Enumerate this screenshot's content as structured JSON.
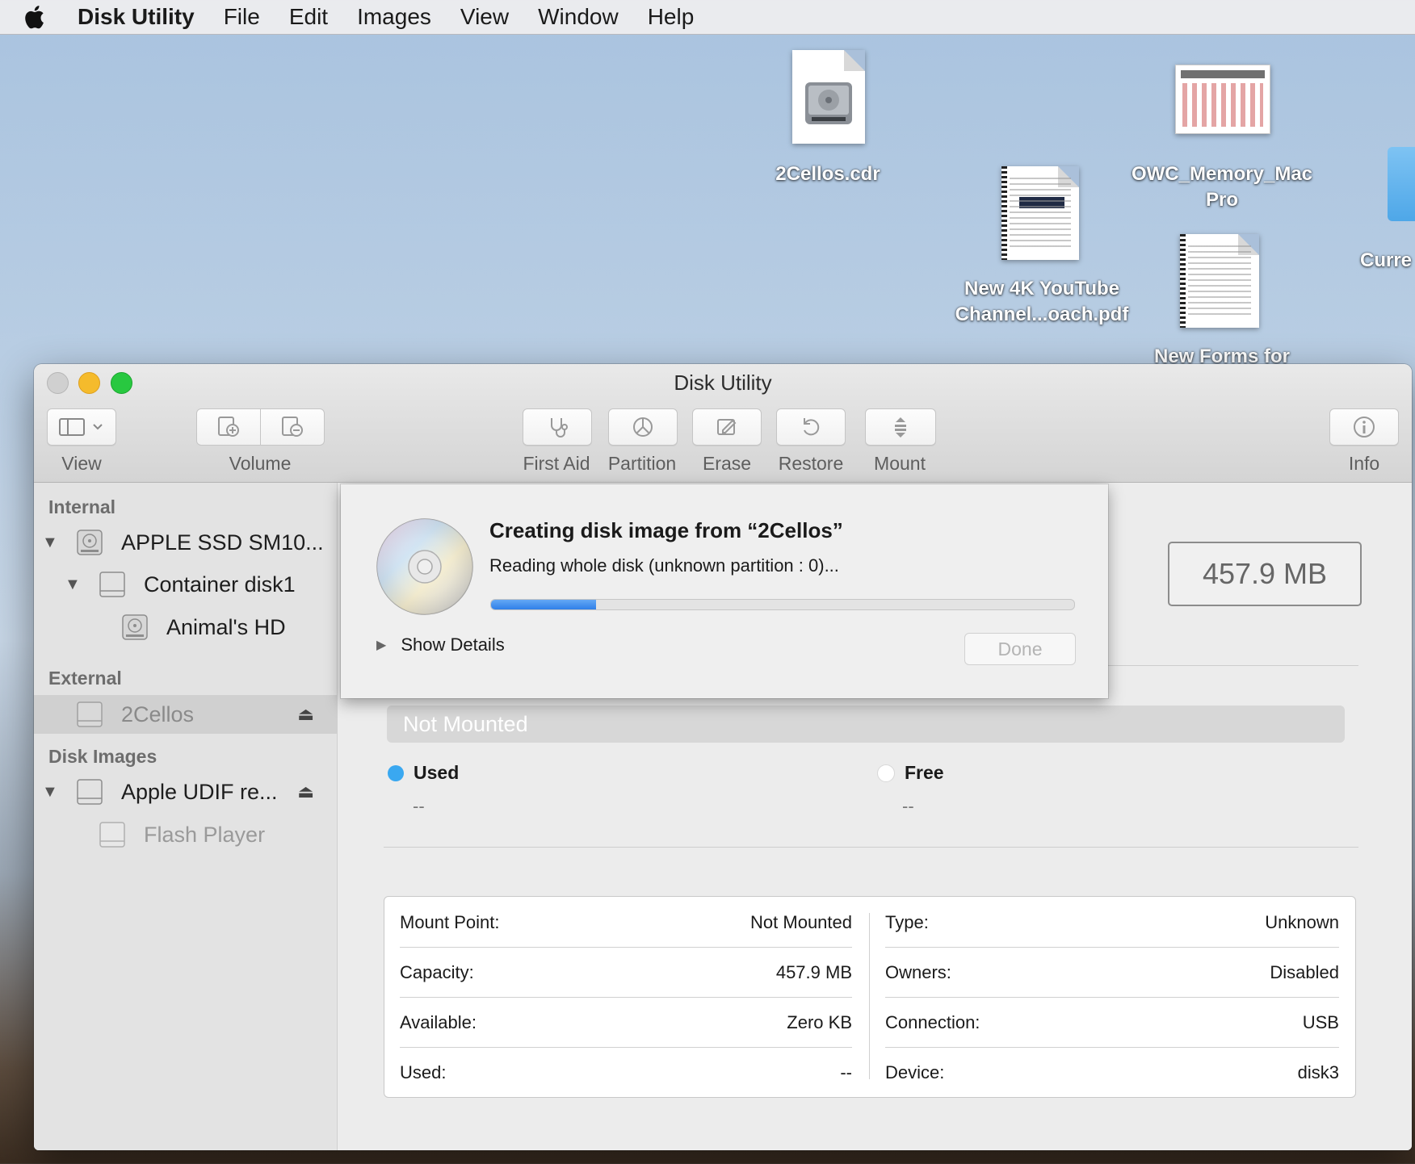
{
  "menubar": {
    "app_name": "Disk Utility",
    "items": [
      "File",
      "Edit",
      "Images",
      "View",
      "Window",
      "Help"
    ]
  },
  "desktop": {
    "icons": [
      {
        "label": "2Cellos.cdr"
      },
      {
        "label": "OWC_Memory_Mac Pro"
      },
      {
        "label": "New 4K YouTube Channel...oach.pdf"
      },
      {
        "label": "New Forms for"
      },
      {
        "label": "Curre O"
      }
    ]
  },
  "window": {
    "title": "Disk Utility",
    "toolbar": {
      "view_label": "View",
      "volume_label": "Volume",
      "first_aid_label": "First Aid",
      "partition_label": "Partition",
      "erase_label": "Erase",
      "restore_label": "Restore",
      "mount_label": "Mount",
      "info_label": "Info"
    }
  },
  "sidebar": {
    "sections": [
      {
        "header": "Internal"
      },
      {
        "header": "External"
      },
      {
        "header": "Disk Images"
      }
    ],
    "items": [
      {
        "label": "APPLE SSD SM10..."
      },
      {
        "label": "Container disk1"
      },
      {
        "label": "Animal's HD"
      },
      {
        "label": "2Cellos"
      },
      {
        "label": "Apple UDIF re..."
      },
      {
        "label": "Flash Player"
      }
    ]
  },
  "main": {
    "size": "457.9 MB",
    "usage_bar_label": "Not Mounted",
    "legend": {
      "used_label": "Used",
      "used_value": "--",
      "used_color": "#3aa8f0",
      "free_label": "Free",
      "free_value": "--",
      "free_color": "#ffffff"
    },
    "info_left": [
      {
        "key": "Mount Point:",
        "value": "Not Mounted"
      },
      {
        "key": "Capacity:",
        "value": "457.9 MB"
      },
      {
        "key": "Available:",
        "value": "Zero KB"
      },
      {
        "key": "Used:",
        "value": "--"
      }
    ],
    "info_right": [
      {
        "key": "Type:",
        "value": "Unknown"
      },
      {
        "key": "Owners:",
        "value": "Disabled"
      },
      {
        "key": "Connection:",
        "value": "USB"
      },
      {
        "key": "Device:",
        "value": "disk3"
      }
    ]
  },
  "sheet": {
    "title": "Creating disk image from “2Cellos”",
    "status": "Reading whole disk (unknown partition : 0)...",
    "progress_fraction": 0.18,
    "show_details_label": "Show Details",
    "done_label": "Done"
  },
  "colors": {
    "accent": "#2f7fe8",
    "traffic_close": "#d0d0d0",
    "traffic_min": "#f5bb2c",
    "traffic_zoom": "#28c840"
  }
}
